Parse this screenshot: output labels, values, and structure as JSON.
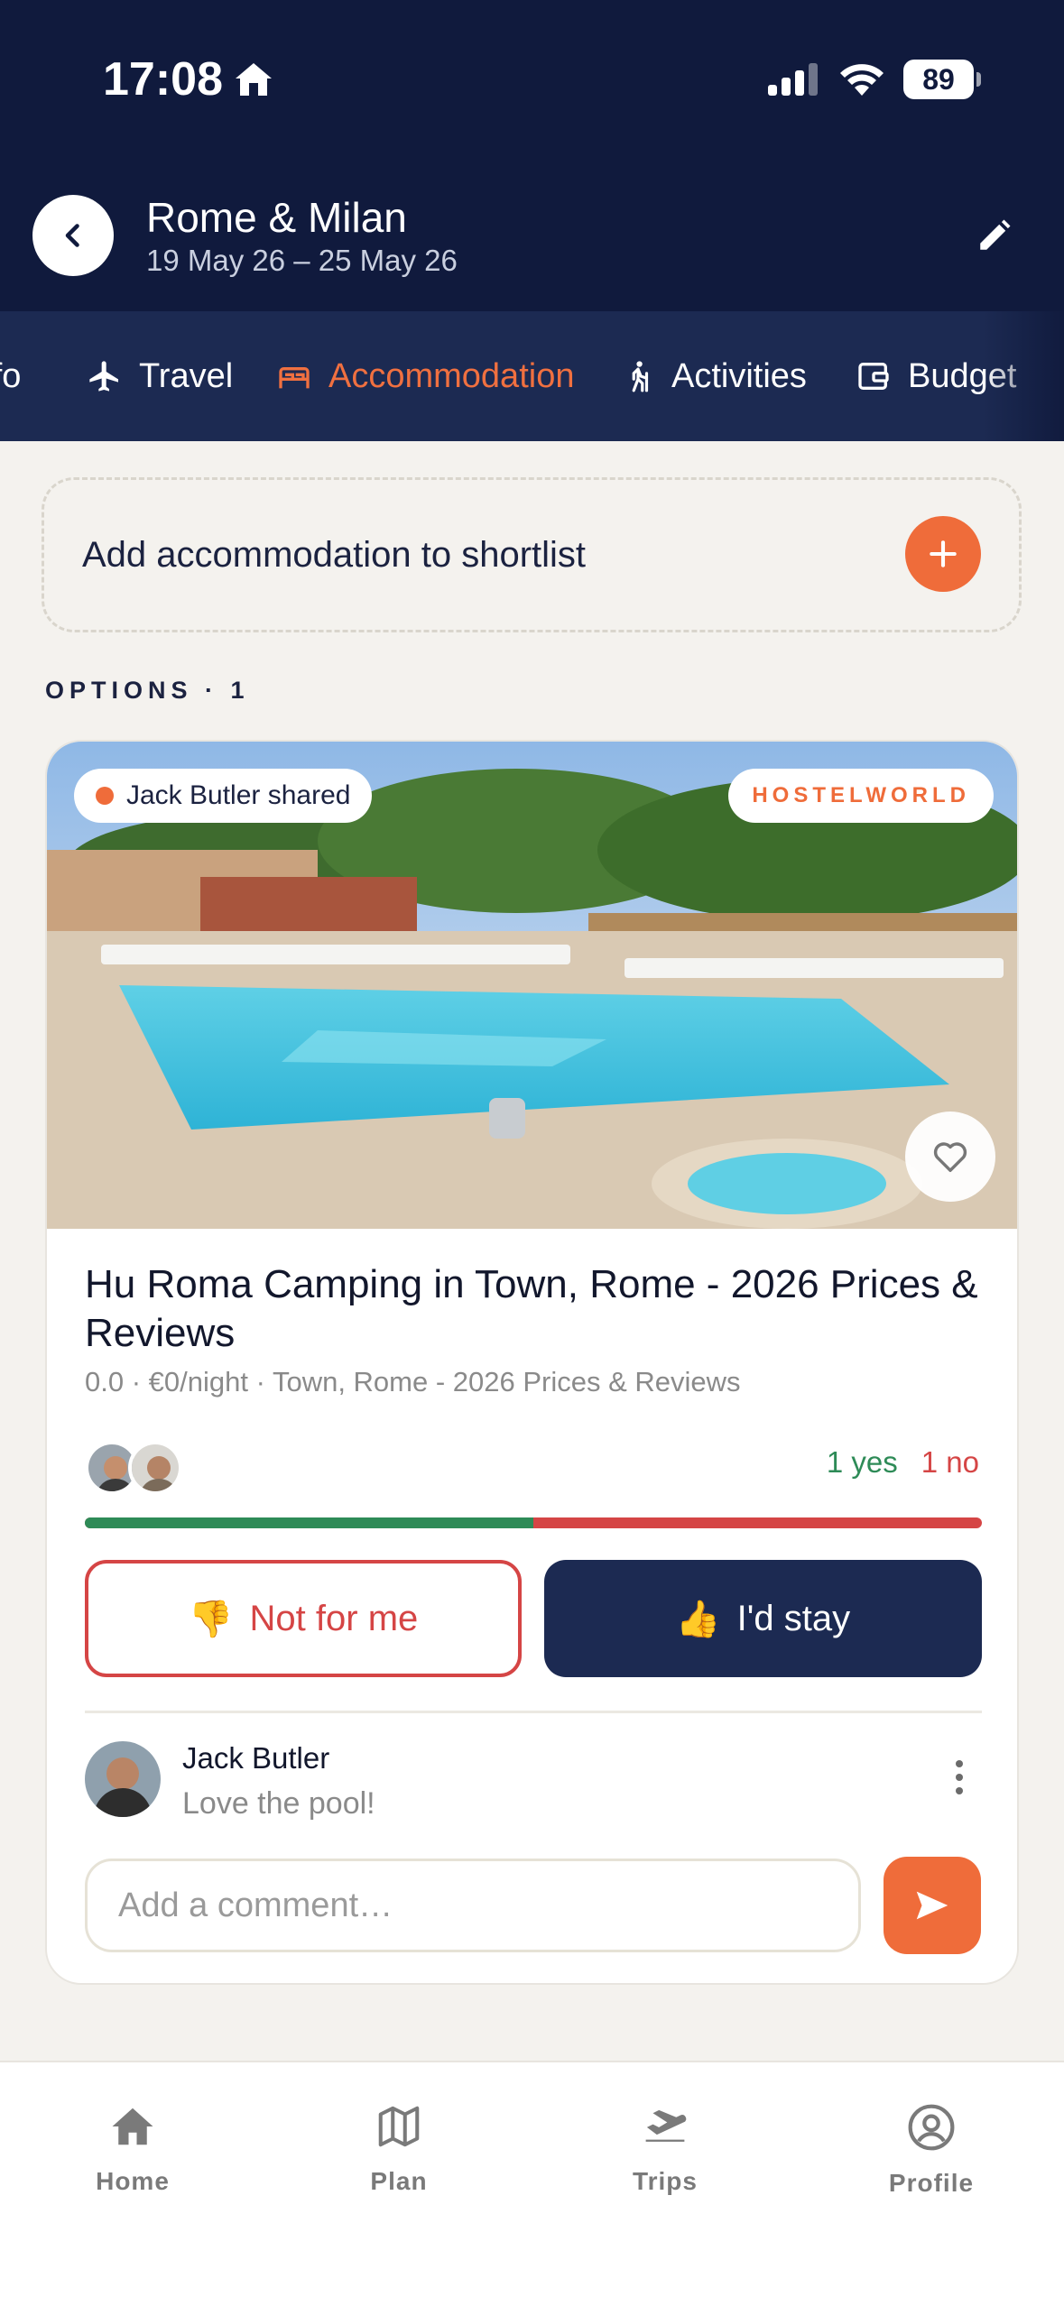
{
  "status_bar": {
    "time": "17:08",
    "battery": "89"
  },
  "header": {
    "title": "Rome & Milan",
    "dates": "19 May 26 – 25 May 26"
  },
  "tabs": [
    {
      "label": "Info",
      "icon": "info-icon"
    },
    {
      "label": "Travel",
      "icon": "plane-icon"
    },
    {
      "label": "Accommodation",
      "icon": "bed-icon",
      "active": true
    },
    {
      "label": "Activities",
      "icon": "hiker-icon"
    },
    {
      "label": "Budget",
      "icon": "wallet-icon"
    }
  ],
  "shortlist": {
    "add_label": "Add accommodation to shortlist"
  },
  "options": {
    "label": "OPTIONS · 1"
  },
  "listing": {
    "shared_by": "Jack Butler shared",
    "source": "HOSTELWORLD",
    "name": "Hu Roma Camping in Town, Rome - 2026 Prices & Reviews",
    "meta": "0.0 · €0/night · Town, Rome - 2026 Prices & Reviews",
    "votes": {
      "yes": "1 yes",
      "no": "1 no",
      "yes_fraction": 0.5
    },
    "not_for_me_label": "Not for me",
    "stay_label": "I'd stay",
    "comment": {
      "author": "Jack Butler",
      "text": "Love the pool!"
    },
    "comment_placeholder": "Add a comment…"
  },
  "bottom_nav": [
    {
      "label": "Home",
      "icon": "home-icon"
    },
    {
      "label": "Plan",
      "icon": "map-icon"
    },
    {
      "label": "Trips",
      "icon": "plane-takeoff-icon"
    },
    {
      "label": "Profile",
      "icon": "profile-icon"
    }
  ],
  "colors": {
    "navy": "#101a3d",
    "tab_bg": "#1c2a52",
    "accent": "#ef6c3a",
    "yes": "#2e8b57",
    "no": "#d54545"
  }
}
